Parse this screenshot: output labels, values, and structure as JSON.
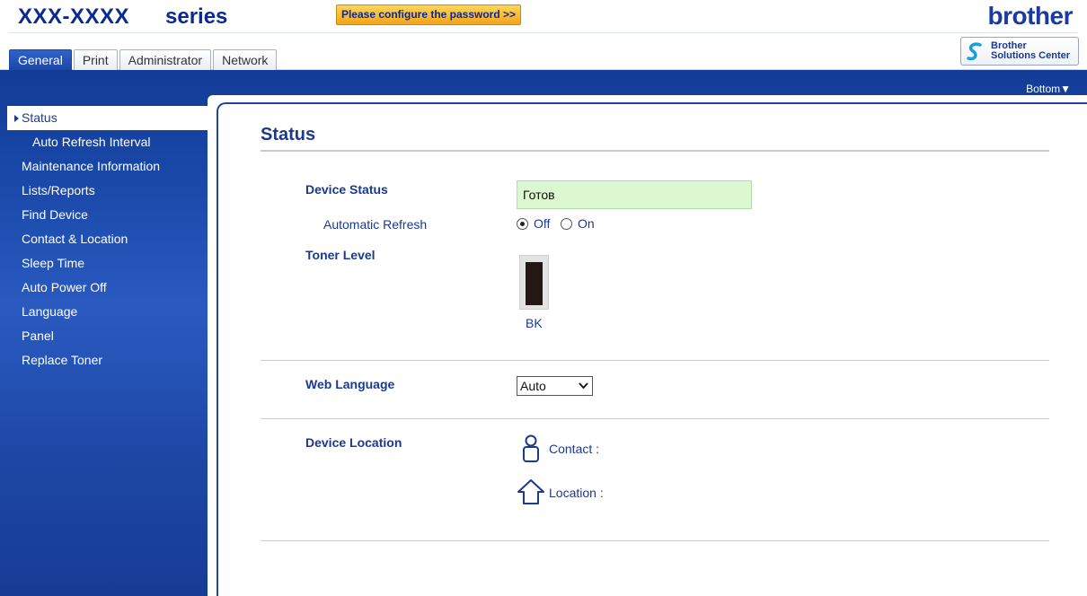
{
  "header": {
    "model": "XXX-XXXX",
    "series": "series",
    "password_banner": "Please configure the password >>",
    "logo": "brother",
    "solutions_center": "Brother\nSolutions Center"
  },
  "tabs": [
    {
      "label": "General",
      "active": true
    },
    {
      "label": "Print"
    },
    {
      "label": "Administrator"
    },
    {
      "label": "Network"
    }
  ],
  "bottom_link": "Bottom▼",
  "sidebar": {
    "items": [
      {
        "label": "Status",
        "active": true
      },
      {
        "label": "Auto Refresh Interval",
        "sub": true
      },
      {
        "label": "Maintenance Information"
      },
      {
        "label": "Lists/Reports"
      },
      {
        "label": "Find Device"
      },
      {
        "label": "Contact & Location"
      },
      {
        "label": "Sleep Time"
      },
      {
        "label": "Auto Power Off"
      },
      {
        "label": "Language"
      },
      {
        "label": "Panel"
      },
      {
        "label": "Replace Toner"
      }
    ]
  },
  "main": {
    "title": "Status",
    "device_status_label": "Device Status",
    "device_status_value": "Готов",
    "auto_refresh_label": "Automatic Refresh",
    "auto_refresh_off": "Off",
    "auto_refresh_on": "On",
    "auto_refresh_selected": "Off",
    "toner_label": "Toner Level",
    "toner_color": "BK",
    "toner_level": 0.95,
    "web_language_label": "Web Language",
    "web_language_value": "Auto",
    "device_location_label": "Device Location",
    "contact_label": "Contact :",
    "location_label": "Location :"
  },
  "colors": {
    "brand_blue": "#1b3a8f",
    "status_ok_bg": "#dcf8d0",
    "banner_orange": "#f3a31a"
  }
}
